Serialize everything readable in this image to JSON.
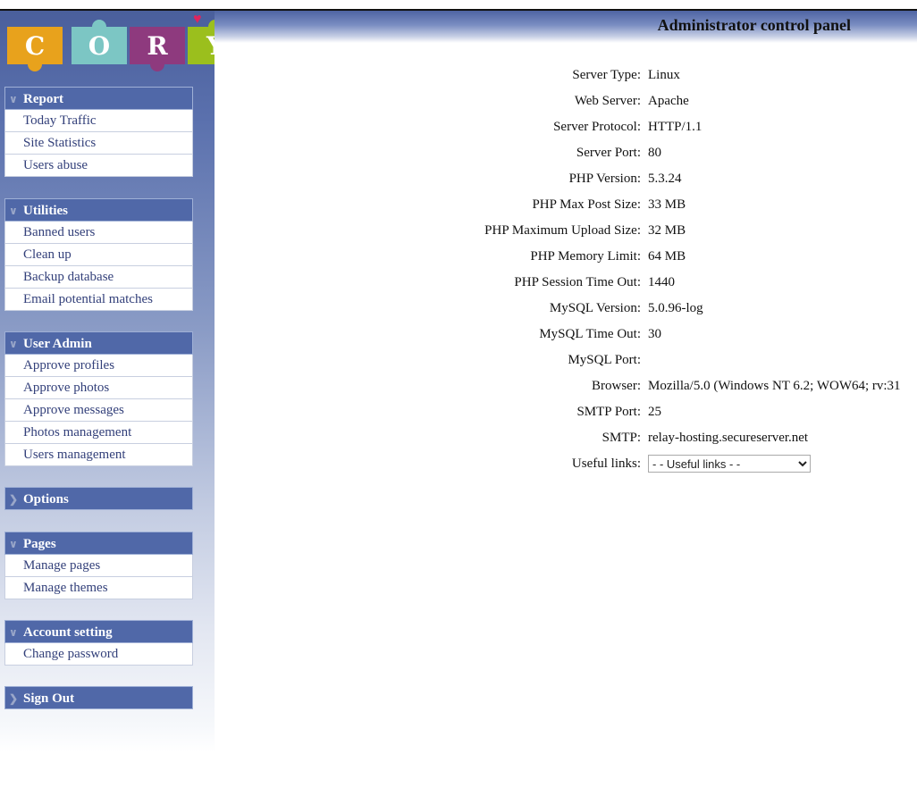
{
  "logo": {
    "letters": [
      "C",
      "O",
      "R",
      "Y"
    ],
    "colors": [
      "#e8a21c",
      "#7cc6c4",
      "#8e3a7e",
      "#9bbf1d"
    ]
  },
  "header": {
    "title": "Administrator control panel"
  },
  "sidebar": {
    "sections": [
      {
        "title": "Report",
        "expanded": true,
        "items": [
          "Today Traffic",
          "Site Statistics",
          "Users abuse"
        ]
      },
      {
        "title": "Utilities",
        "expanded": true,
        "items": [
          "Banned users",
          "Clean up",
          "Backup database",
          "Email potential matches"
        ]
      },
      {
        "title": "User Admin",
        "expanded": true,
        "items": [
          "Approve profiles",
          "Approve photos",
          "Approve messages",
          "Photos management",
          "Users management"
        ]
      },
      {
        "title": "Options",
        "expanded": false,
        "items": []
      },
      {
        "title": "Pages",
        "expanded": true,
        "items": [
          "Manage pages",
          "Manage themes"
        ]
      },
      {
        "title": "Account setting",
        "expanded": true,
        "items": [
          "Change password"
        ]
      },
      {
        "title": "Sign Out",
        "expanded": false,
        "items": []
      }
    ]
  },
  "info": [
    {
      "label": "Server Type:",
      "value": "Linux"
    },
    {
      "label": "Web Server:",
      "value": "Apache"
    },
    {
      "label": "Server Protocol:",
      "value": "HTTP/1.1"
    },
    {
      "label": "Server Port:",
      "value": "80"
    },
    {
      "label": "PHP Version:",
      "value": "5.3.24"
    },
    {
      "label": "PHP Max Post Size:",
      "value": "33 MB"
    },
    {
      "label": "PHP Maximum Upload Size:",
      "value": "32 MB"
    },
    {
      "label": "PHP Memory Limit:",
      "value": "64 MB"
    },
    {
      "label": "PHP Session Time Out:",
      "value": "1440"
    },
    {
      "label": "MySQL Version:",
      "value": "5.0.96-log"
    },
    {
      "label": "MySQL Time Out:",
      "value": "30"
    },
    {
      "label": "MySQL Port:",
      "value": ""
    },
    {
      "label": "Browser:",
      "value": "Mozilla/5.0 (Windows NT 6.2; WOW64; rv:31"
    },
    {
      "label": "SMTP Port:",
      "value": "25"
    },
    {
      "label": "SMTP:",
      "value": "relay-hosting.secureserver.net"
    }
  ],
  "useful_links": {
    "label": "Useful links:",
    "selected": "- - Useful links - -"
  }
}
